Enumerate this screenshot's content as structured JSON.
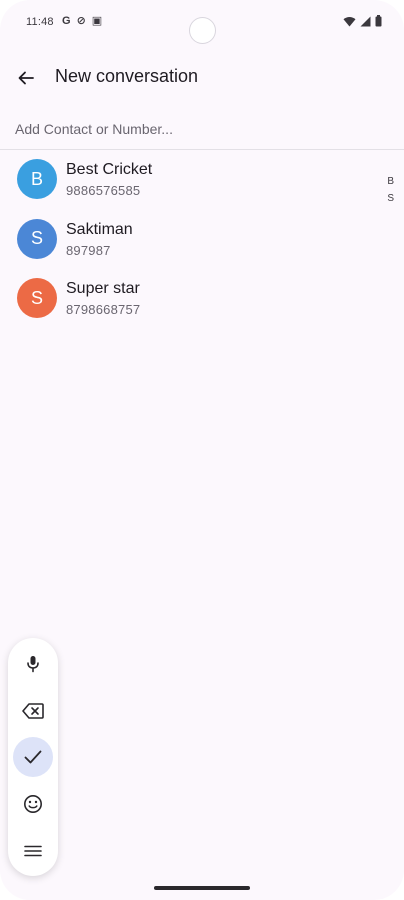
{
  "status_bar": {
    "time": "11:48",
    "left_icons": [
      "G",
      "⊘",
      "▣"
    ],
    "right_icons": [
      "wifi-icon",
      "signal-icon",
      "battery-icon"
    ]
  },
  "app_bar": {
    "title": "New conversation",
    "back_icon": "arrow-back-icon"
  },
  "contact_search": {
    "placeholder": "Add Contact or Number...",
    "value": ""
  },
  "contacts": [
    {
      "initial": "B",
      "name": "Best Cricket",
      "number": "9886576585",
      "color": "#3a9fe0"
    },
    {
      "initial": "S",
      "name": "Saktiman",
      "number": "897987",
      "color": "#4b87d6"
    },
    {
      "initial": "S",
      "name": "Super star",
      "number": "8798668757",
      "color": "#ec6a45"
    }
  ],
  "index_letters": [
    "B",
    "S"
  ],
  "keyboard_toolbar": {
    "items": [
      "microphone-icon",
      "backspace-icon",
      "checkmark-icon",
      "emoji-icon",
      "menu-icon"
    ],
    "active_item": "checkmark-icon",
    "active_color": "#dde3f8"
  }
}
